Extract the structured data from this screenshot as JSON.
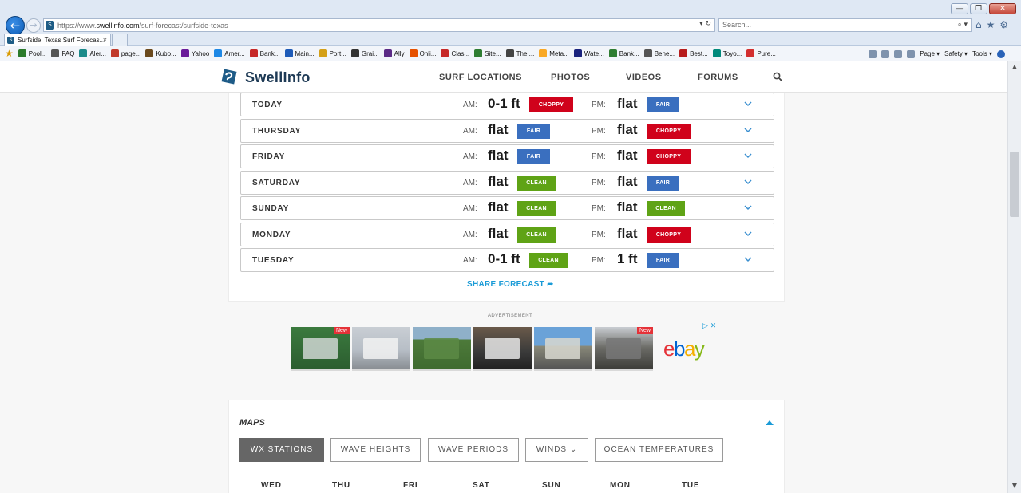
{
  "browser": {
    "url_prefix": "https://www.",
    "url_domain": "swellinfo.com",
    "url_path": "/surf-forecast/surfside-texas",
    "search_placeholder": "Search...",
    "tab_title": "Surfside, Texas Surf Forecas...",
    "tab_close": "×",
    "favorites": [
      "Pool...",
      "FAQ",
      "Aler...",
      "page...",
      "Kubo...",
      "Yahoo",
      "Amer...",
      "Bank...",
      "Main...",
      "Port...",
      "Grai...",
      "Ally",
      "Onli...",
      "Clas...",
      "Site...",
      "The ...",
      "Meta...",
      "Wate...",
      "Bank...",
      "Bene...",
      "Best...",
      "Toyo...",
      "Pure..."
    ],
    "commands": [
      "Page ▾",
      "Safety ▾",
      "Tools ▾"
    ]
  },
  "header": {
    "logo": "SwellInfo",
    "nav": [
      "SURF LOCATIONS",
      "PHOTOS",
      "VIDEOS",
      "FORUMS"
    ]
  },
  "forecast": {
    "am_label": "AM:",
    "pm_label": "PM:",
    "days": [
      {
        "day": "TODAY",
        "am_height": "0-1 ft",
        "am_cond": "CHOPPY",
        "pm_height": "flat",
        "pm_cond": "FAIR"
      },
      {
        "day": "THURSDAY",
        "am_height": "flat",
        "am_cond": "FAIR",
        "pm_height": "flat",
        "pm_cond": "CHOPPY"
      },
      {
        "day": "FRIDAY",
        "am_height": "flat",
        "am_cond": "FAIR",
        "pm_height": "flat",
        "pm_cond": "CHOPPY"
      },
      {
        "day": "SATURDAY",
        "am_height": "flat",
        "am_cond": "CLEAN",
        "pm_height": "flat",
        "pm_cond": "FAIR"
      },
      {
        "day": "SUNDAY",
        "am_height": "flat",
        "am_cond": "CLEAN",
        "pm_height": "flat",
        "pm_cond": "CLEAN"
      },
      {
        "day": "MONDAY",
        "am_height": "flat",
        "am_cond": "CLEAN",
        "pm_height": "flat",
        "pm_cond": "CHOPPY"
      },
      {
        "day": "TUESDAY",
        "am_height": "0-1 ft",
        "am_cond": "CLEAN",
        "pm_height": "1 ft",
        "pm_cond": "FAIR"
      }
    ],
    "share_label": "SHARE FORECAST"
  },
  "ad": {
    "label": "ADVERTISEMENT",
    "new_badge": "New",
    "brand": [
      "e",
      "b",
      "a",
      "y"
    ],
    "brand_colors": [
      "#e53238",
      "#0064d2",
      "#f5af02",
      "#86b817"
    ]
  },
  "maps": {
    "title": "MAPS",
    "buttons": [
      "WX STATIONS",
      "WAVE HEIGHTS",
      "WAVE PERIODS",
      "WINDS ⌄",
      "OCEAN TEMPERATURES"
    ],
    "days": [
      "WED",
      "THU",
      "FRI",
      "SAT",
      "SUN",
      "MON",
      "TUE"
    ]
  },
  "colors": {
    "fair": "#3a6fbf",
    "choppy": "#d0021b",
    "clean": "#5fa316",
    "accent": "#1a9bd7"
  }
}
